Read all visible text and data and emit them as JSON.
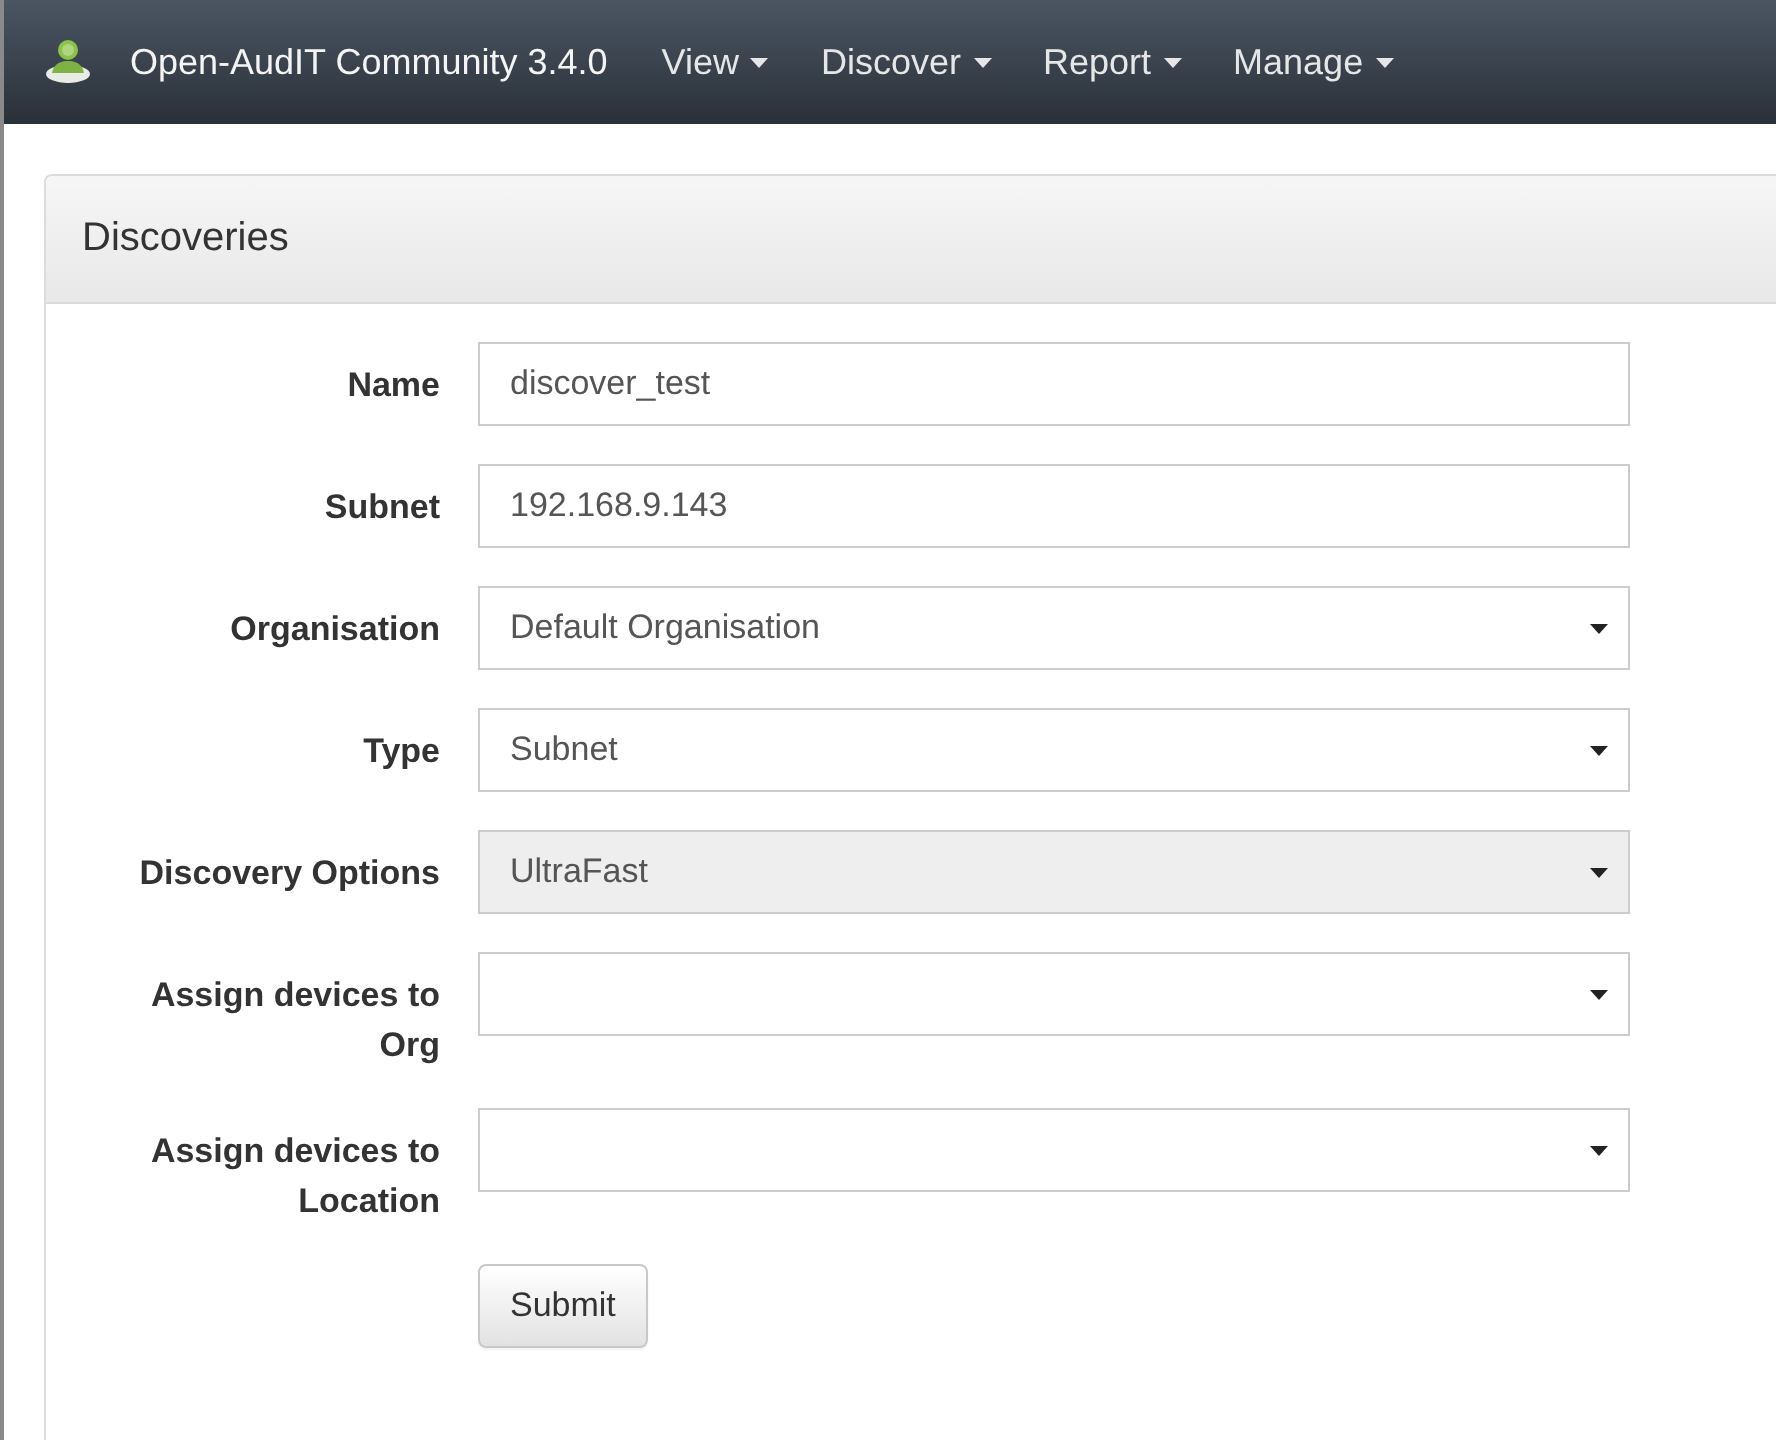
{
  "navbar": {
    "brand": "Open-AudIT Community 3.4.0",
    "menus": [
      {
        "label": "View"
      },
      {
        "label": "Discover"
      },
      {
        "label": "Report"
      },
      {
        "label": "Manage"
      }
    ]
  },
  "panel": {
    "title": "Discoveries",
    "fields": [
      {
        "label": "Name",
        "kind": "text",
        "value": "discover_test",
        "disabled": false
      },
      {
        "label": "Subnet",
        "kind": "text",
        "value": "192.168.9.143",
        "disabled": false
      },
      {
        "label": "Organisation",
        "kind": "select",
        "value": "Default Organisation",
        "disabled": false
      },
      {
        "label": "Type",
        "kind": "select",
        "value": "Subnet",
        "disabled": false
      },
      {
        "label": "Discovery Options",
        "kind": "select",
        "value": "UltraFast",
        "disabled": true
      },
      {
        "label": "Assign devices to Org",
        "kind": "select",
        "disabled": false
      },
      {
        "label": "Assign devices to Location",
        "kind": "select",
        "disabled": false
      }
    ],
    "submit": "Submit"
  }
}
